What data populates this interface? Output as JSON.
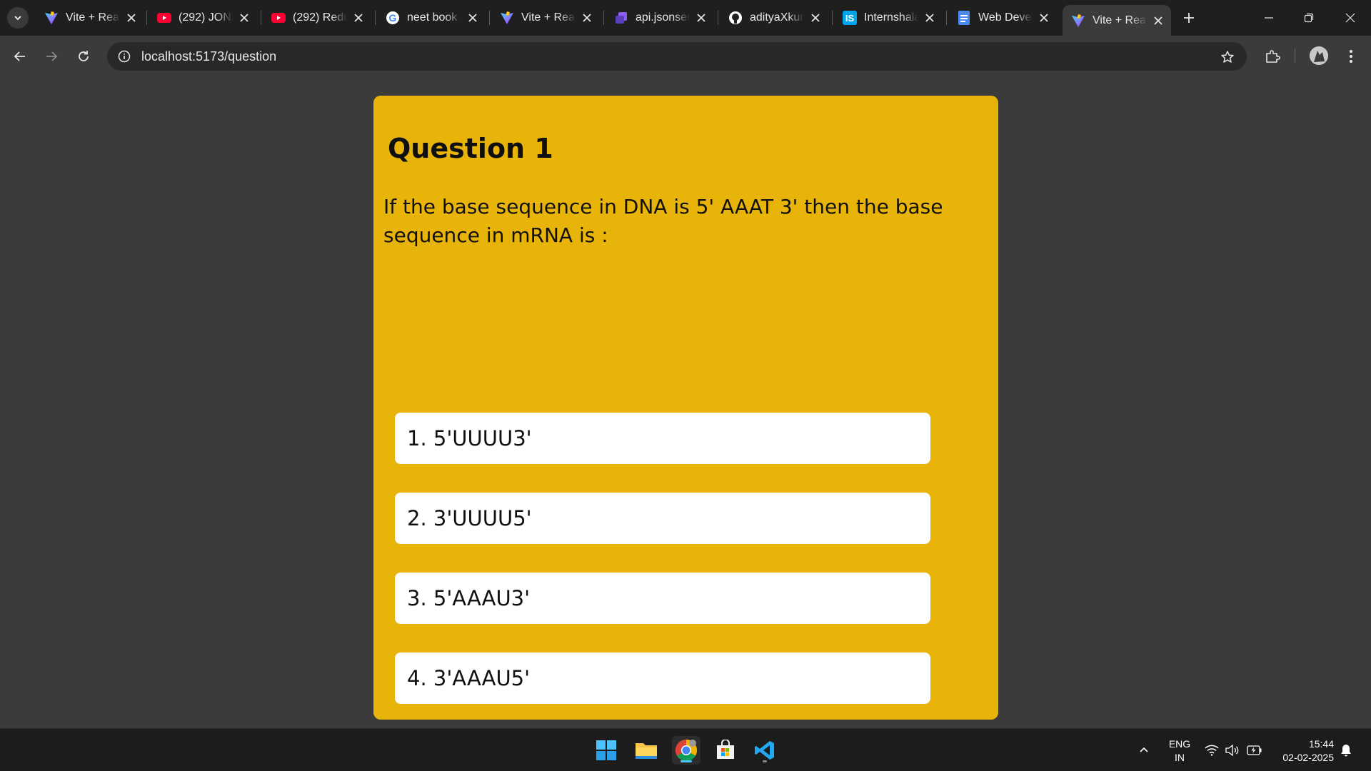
{
  "browser": {
    "tabs": [
      {
        "title": "Vite + React",
        "icon": "vite-icon"
      },
      {
        "title": "(292) JONAS",
        "icon": "youtube-icon"
      },
      {
        "title": "(292) Redux",
        "icon": "youtube-icon"
      },
      {
        "title": "neet book",
        "icon": "google-icon"
      },
      {
        "title": "Vite + React",
        "icon": "vite-icon"
      },
      {
        "title": "api.jsonserve",
        "icon": "jsonserve-icon"
      },
      {
        "title": "adityaXkumar",
        "icon": "github-icon"
      },
      {
        "title": "Internshala",
        "icon": "internshala-icon"
      },
      {
        "title": "Web Develop",
        "icon": "docs-icon"
      },
      {
        "title": "Vite + React",
        "icon": "vite-icon",
        "active": true
      }
    ],
    "url": "localhost:5173/question"
  },
  "quiz": {
    "title": "Question 1",
    "question": "If the base sequence in DNA is 5' AAAT 3' then the base sequence in mRNA is :",
    "options": [
      "1. 5'UUUU3'",
      "2. 3'UUUU5'",
      "3. 5'AAAU3'",
      "4. 3'AAAU5'"
    ],
    "card_color": "#e8b40a"
  },
  "taskbar": {
    "apps": [
      "windows-start-icon",
      "file-explorer-icon",
      "chrome-icon",
      "microsoft-store-icon",
      "vscode-icon"
    ],
    "language": {
      "line1": "ENG",
      "line2": "IN"
    },
    "time": "15:44",
    "date": "02-02-2025"
  }
}
